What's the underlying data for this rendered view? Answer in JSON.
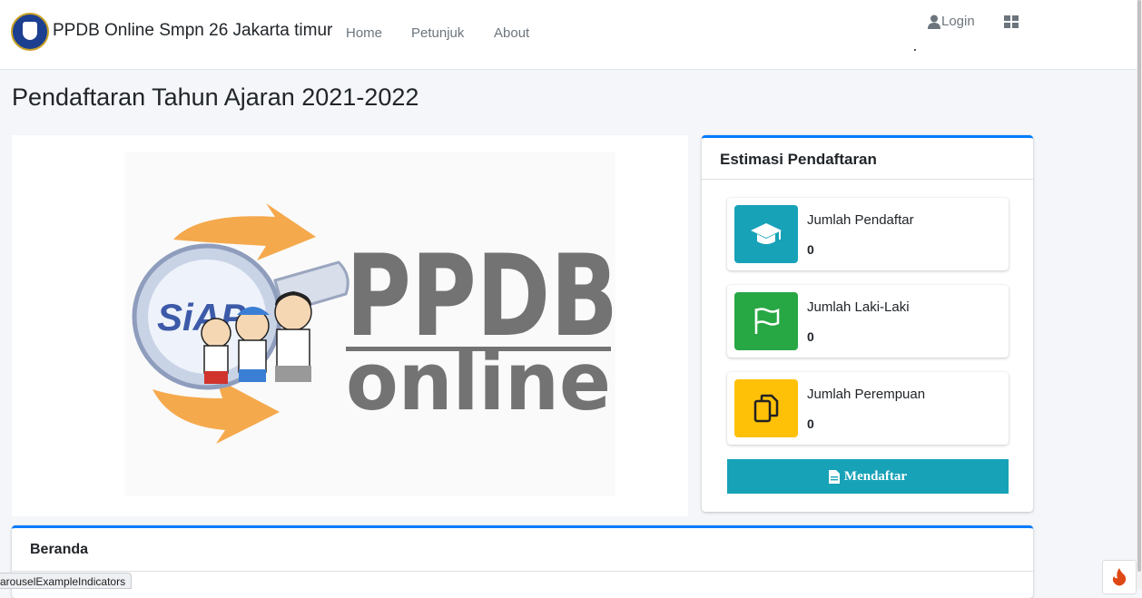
{
  "navbar": {
    "brand": "PPDB Online Smpn 26 Jakarta timur",
    "links": [
      "Home",
      "Petunjuk",
      "About"
    ],
    "login": "Login"
  },
  "page_title": "Pendaftaran Tahun Ajaran 2021-2022",
  "banner": {
    "logo_text_top": "PPDB",
    "logo_text_bottom": "online",
    "siap_text": "SiAP"
  },
  "estimasi": {
    "title": "Estimasi Pendaftaran",
    "items": [
      {
        "label": "Jumlah Pendaftar",
        "value": "0",
        "icon": "graduation-cap-icon",
        "color": "#17a2b8"
      },
      {
        "label": "Jumlah Laki-Laki",
        "value": "0",
        "icon": "flag-icon",
        "color": "#28a745"
      },
      {
        "label": "Jumlah Perempuan",
        "value": "0",
        "icon": "copy-icon",
        "color": "#ffc107"
      }
    ],
    "button": "Mendaftar"
  },
  "beranda": {
    "title": "Beranda"
  },
  "status_bar": "arouselExampleIndicators",
  "colors": {
    "primary": "#007bff",
    "info": "#17a2b8",
    "success": "#28a745",
    "warning": "#ffc107"
  }
}
